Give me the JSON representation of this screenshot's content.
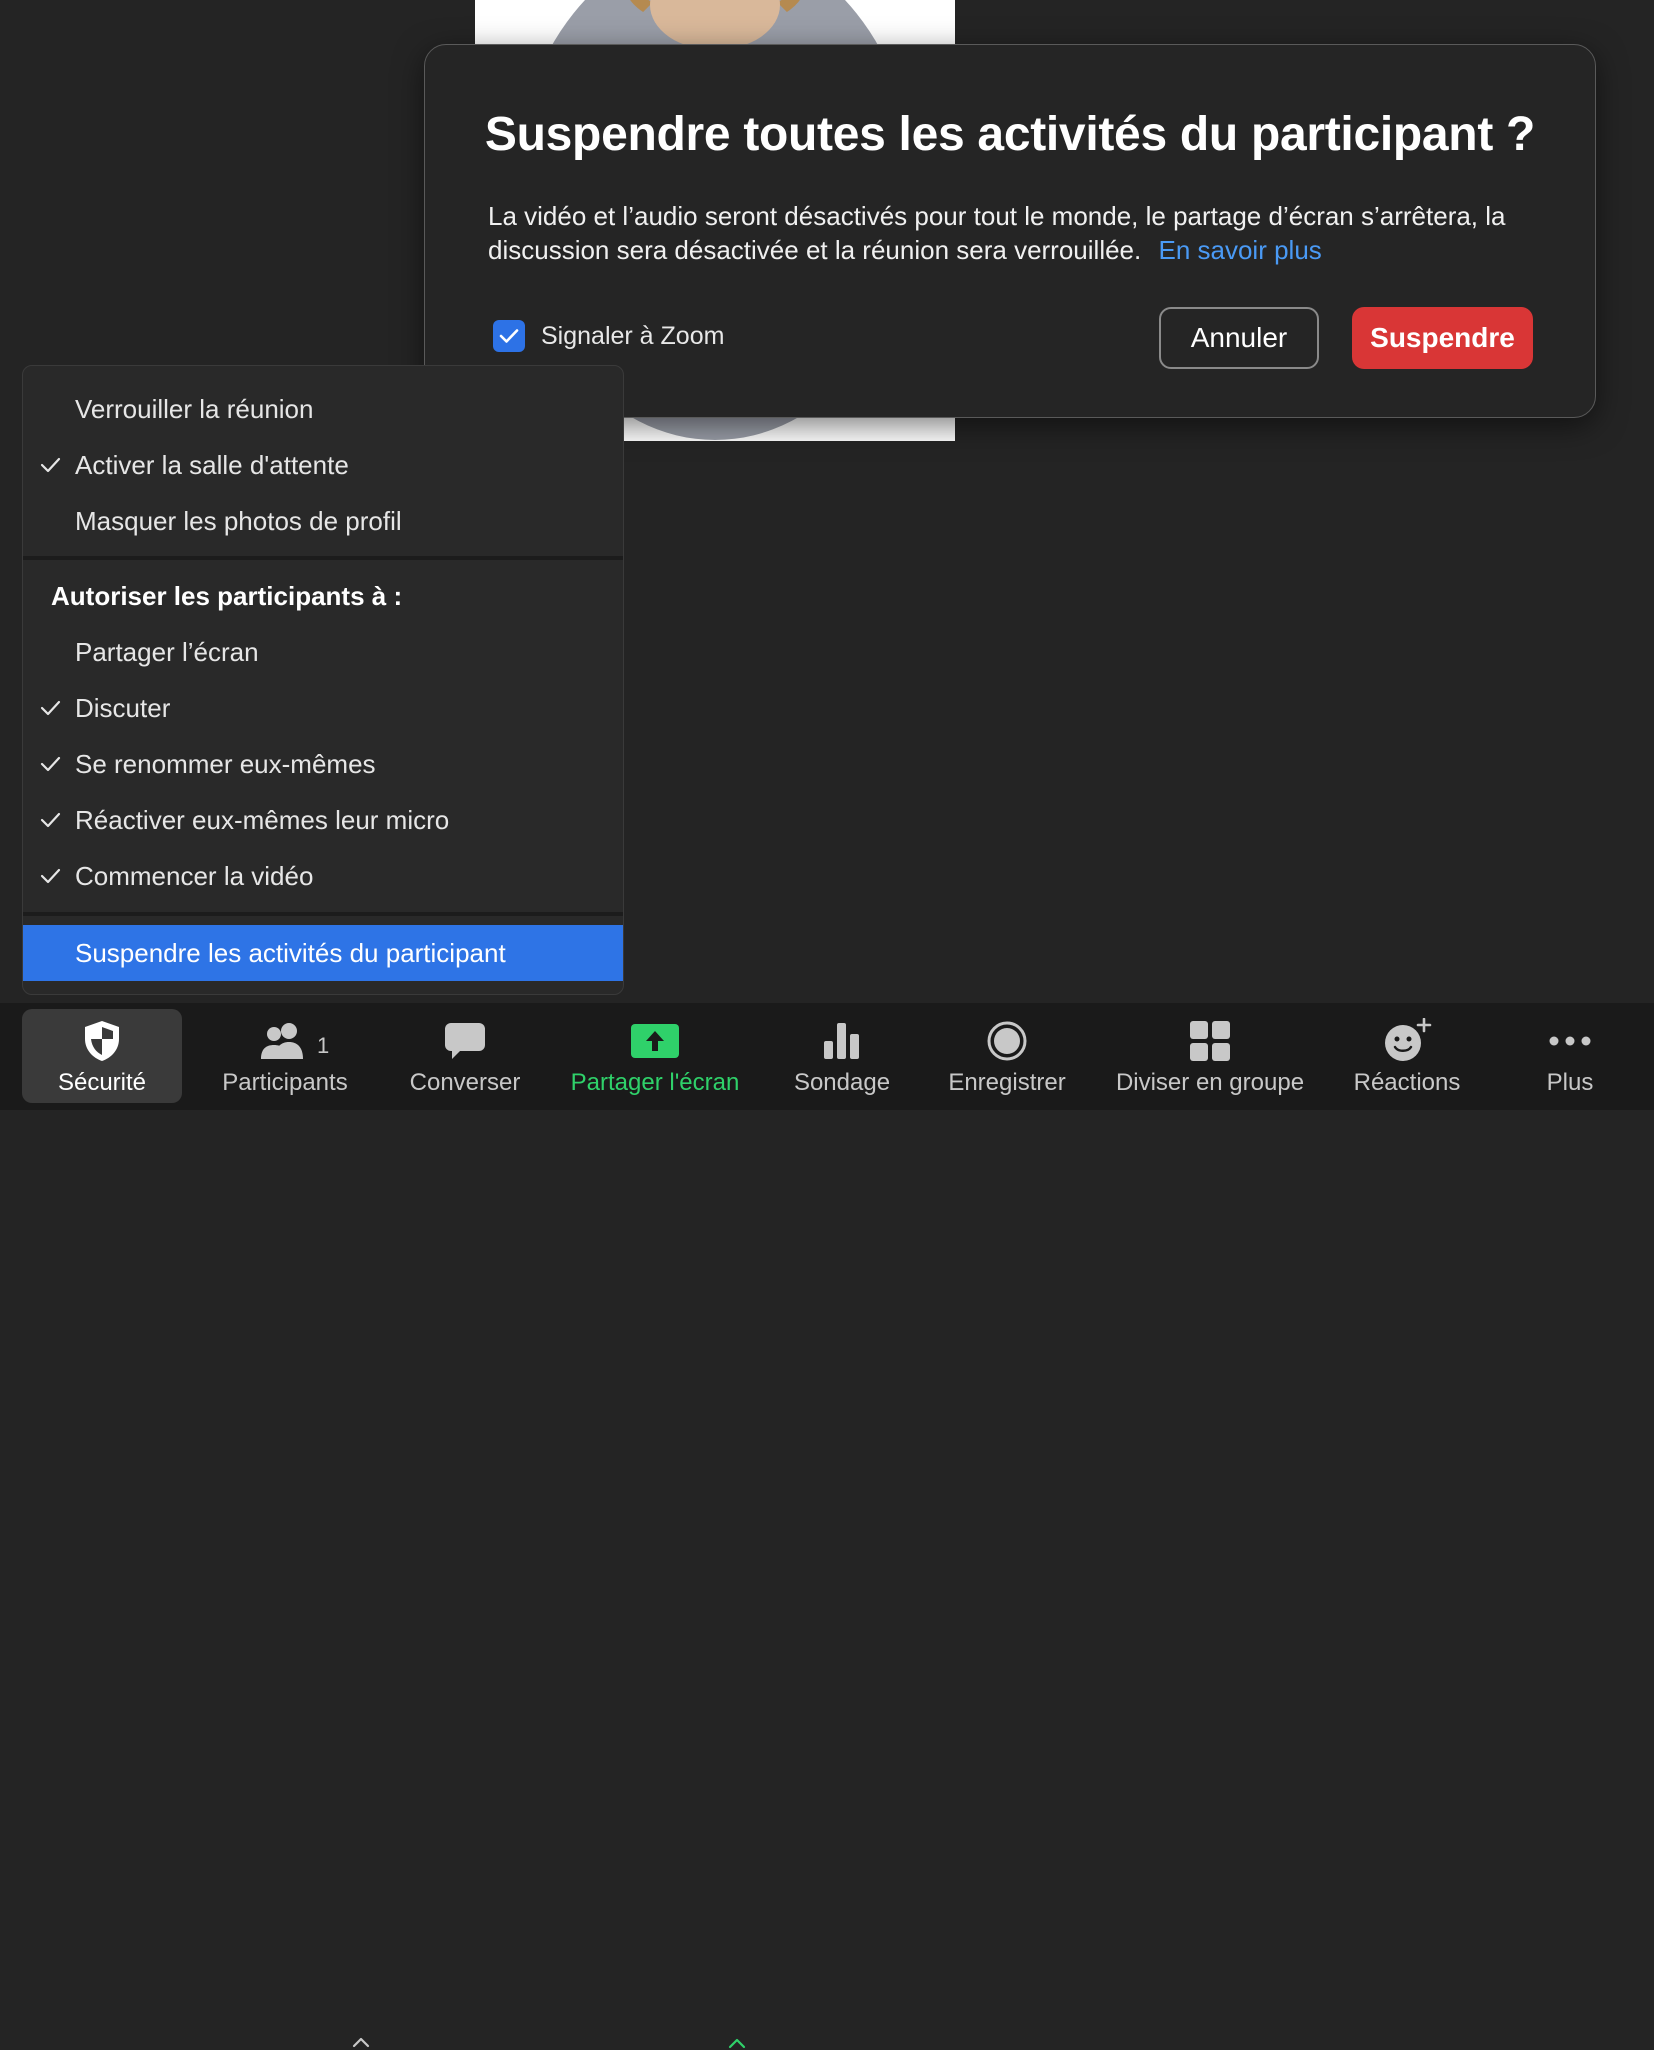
{
  "dialog": {
    "title": "Suspendre toutes les activités du participant ?",
    "body": "La vidéo et l’audio seront désactivés pour tout le monde, le partage d’écran s’arrêtera, la discussion sera désactivée et la réunion sera verrouillée.",
    "learn_more": "En savoir plus",
    "report_label": "Signaler à Zoom",
    "report_checked": true,
    "cancel_label": "Annuler",
    "suspend_label": "Suspendre"
  },
  "security_menu": {
    "items_top": [
      {
        "label": "Verrouiller la réunion",
        "checked": false
      },
      {
        "label": "Activer la salle d'attente",
        "checked": true
      },
      {
        "label": "Masquer les photos de profil",
        "checked": false
      }
    ],
    "section_header": "Autoriser les participants à :",
    "items_allow": [
      {
        "label": "Partager l’écran",
        "checked": false
      },
      {
        "label": "Discuter",
        "checked": true
      },
      {
        "label": "Se renommer eux-mêmes",
        "checked": true
      },
      {
        "label": "Réactiver eux-mêmes leur micro",
        "checked": true
      },
      {
        "label": "Commencer la vidéo",
        "checked": true
      }
    ],
    "suspend_item": "Suspendre les activités du participant"
  },
  "toolbar": {
    "security": "Sécurité",
    "participants": "Participants",
    "participants_count": "1",
    "chat": "Converser",
    "share": "Partager l'écran",
    "poll": "Sondage",
    "record": "Enregistrer",
    "breakout": "Diviser en groupe",
    "reactions": "Réactions",
    "more": "Plus"
  },
  "colors": {
    "accent_blue": "#2e74e6",
    "danger_red": "#d93636",
    "share_green": "#2fd16a",
    "link_blue": "#4a9af5"
  }
}
